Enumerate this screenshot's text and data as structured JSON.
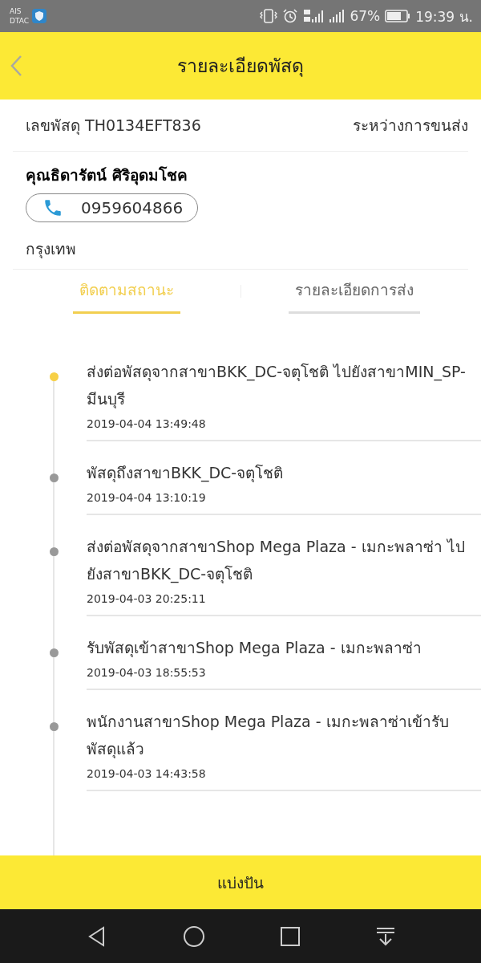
{
  "status_bar": {
    "carriers": [
      "AIS",
      "DTAC"
    ],
    "battery_percent": "67%",
    "time": "19:39 น."
  },
  "header": {
    "title": "รายละเอียดพัสดุ"
  },
  "parcel": {
    "number_label": "เลขพัสดุ TH0134EFT836",
    "status": "ระหว่างการขนส่ง",
    "recipient": "คุณธิดารัตน์ ศิริอุดมโชค",
    "phone": "0959604866",
    "city": "กรุงเทพ"
  },
  "tabs": [
    {
      "label": "ติดตามสถานะ",
      "selected": true
    },
    {
      "label": "รายละเอียดการส่ง",
      "selected": false
    }
  ],
  "events": [
    {
      "text": "ส่งต่อพัสดุจากสาขาBKK_DC-จตุโชติ ไปยังสาขาMIN_SP-มีนบุรี",
      "time": "2019-04-04 13:49:48",
      "current": true
    },
    {
      "text": "พัสดุถึงสาขาBKK_DC-จตุโชติ",
      "time": "2019-04-04 13:10:19",
      "current": false
    },
    {
      "text": "ส่งต่อพัสดุจากสาขาShop Mega Plaza - เมกะพลาซ่า ไปยังสาขาBKK_DC-จตุโชติ",
      "time": "2019-04-03 20:25:11",
      "current": false
    },
    {
      "text": "รับพัสดุเข้าสาขาShop Mega Plaza - เมกะพลาซ่า",
      "time": "2019-04-03 18:55:53",
      "current": false
    },
    {
      "text": "พนักงานสาขาShop Mega Plaza - เมกะพลาซ่าเข้ารับพัสดุแล้ว",
      "time": "2019-04-03 14:43:58",
      "current": false
    }
  ],
  "bottom_button": {
    "label": "แบ่งปัน"
  }
}
